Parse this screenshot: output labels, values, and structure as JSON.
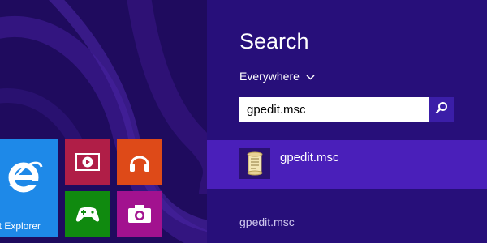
{
  "colors": {
    "start_background": "#1f0b5e",
    "pane_background": "#270f7a",
    "selected_result": "#4a1fba",
    "search_button": "#3b1ea8",
    "ie_tile": "#1e89e8",
    "video_tile": "#b01e47",
    "music_tile": "#de4a18",
    "games_tile": "#108a0f",
    "camera_tile": "#a2128f"
  },
  "start_screen": {
    "tiles": [
      {
        "id": "internet-explorer",
        "label": "et Explorer",
        "icon": "internet-explorer-icon"
      },
      {
        "id": "video",
        "label": "",
        "icon": "video-play-icon"
      },
      {
        "id": "music",
        "label": "",
        "icon": "headphones-icon"
      },
      {
        "id": "games",
        "label": "",
        "icon": "game-controller-icon"
      },
      {
        "id": "camera",
        "label": "",
        "icon": "camera-icon"
      }
    ]
  },
  "search_pane": {
    "title": "Search",
    "scope": {
      "label": "Everywhere",
      "icon": "chevron-down-icon"
    },
    "query": "gpedit.msc",
    "search_button_icon": "magnifier-icon",
    "results": [
      {
        "label": "gpedit.msc",
        "icon": "scroll-document-icon",
        "selected": true
      },
      {
        "label": "gpedit.msc",
        "selected": false
      }
    ]
  }
}
